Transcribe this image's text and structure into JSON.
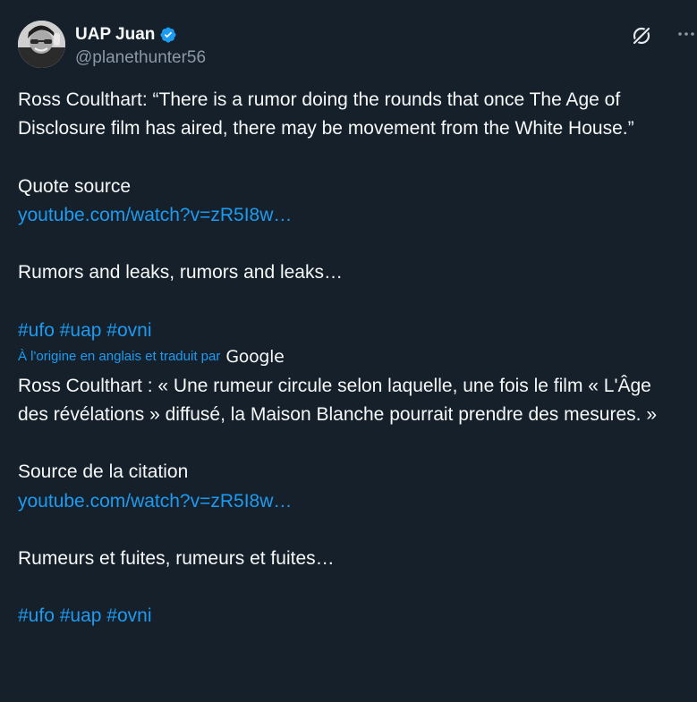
{
  "author": {
    "display_name": "UAP Juan",
    "handle": "@planethunter56",
    "verified": true,
    "avatar": "avatar-photo"
  },
  "icons": {
    "verified": "verified-badge-icon",
    "grok": "grok-icon",
    "more": "more-options-icon"
  },
  "colors": {
    "background": "#15202b",
    "text": "#f7f9f9",
    "secondary": "#8b98a5",
    "link": "#1d9bf0"
  },
  "original": {
    "quote": "Ross Coulthart: “There is a rumor doing the rounds that once The Age of Disclosure film has aired, there may be movement from the White House.”",
    "source_label": "Quote source",
    "source_link": "youtube.com/watch?v=zR5I8w…",
    "comment": "Rumors and leaks, rumors and leaks…",
    "hashtags": [
      "#ufo",
      "#uap",
      "#ovni"
    ]
  },
  "translation": {
    "note": "À l'origine en anglais et traduit par",
    "provider": "Google",
    "quote": "Ross Coulthart : « Une rumeur circule selon laquelle, une fois le film « L'Âge des révélations » diffusé, la Maison Blanche pourrait prendre des mesures. »",
    "source_label": "Source de la citation",
    "source_link": "youtube.com/watch?v=zR5I8w…",
    "comment": "Rumeurs et fuites, rumeurs et fuites…",
    "hashtags": [
      "#ufo",
      "#uap",
      "#ovni"
    ]
  }
}
